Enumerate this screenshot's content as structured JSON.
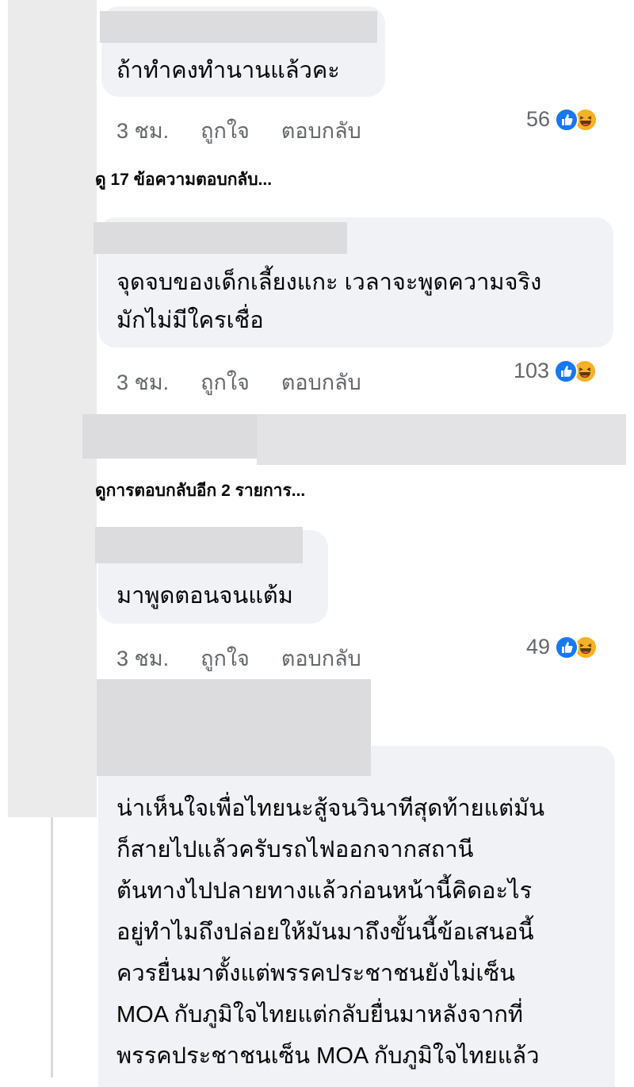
{
  "comments": [
    {
      "text_lines": [
        "ถ้าทำคงทำนานแล้วคะ"
      ],
      "time": "3 ชม.",
      "like_label": "ถูกใจ",
      "reply_label": "ตอบกลับ",
      "reaction_count": "56",
      "reactions": [
        "like-icon",
        "haha-icon"
      ]
    },
    {
      "text_lines": [
        "จุดจบของเด็กเลี้ยงแกะ เวลาจะพูดความจริง",
        "มักไม่มีใครเชื่อ"
      ],
      "time": "3 ชม.",
      "like_label": "ถูกใจ",
      "reply_label": "ตอบกลับ",
      "reaction_count": "103",
      "reactions": [
        "like-icon",
        "haha-icon"
      ]
    },
    {
      "text_lines": [
        "มาพูดตอนจนแต้ม"
      ],
      "time": "3 ชม.",
      "like_label": "ถูกใจ",
      "reply_label": "ตอบกลับ",
      "reaction_count": "49",
      "reactions": [
        "like-icon",
        "haha-icon"
      ]
    },
    {
      "text_lines": [
        "น่าเห็นใจเพื่อไทยนะสู้จนวินาทีสุดท้ายแต่มัน",
        "ก็สายไปแล้วครับรถไฟออกจากสถานี",
        "ต้นทางไปปลายทางแล้วก่อนหน้านี้คิดอะไร",
        "อยู่ทำไมถึงปล่อยให้มันมาถึงขั้นนี้ข้อเสนอนี้",
        "ควรยื่นมาตั้งแต่พรรคประชาชนยังไม่เซ็น",
        "MOA กับภูมิใจไทยแต่กลับยื่นมาหลังจากที่",
        "พรรคประชาชนเซ็น MOA กับภูมิใจไทยแล้ว"
      ]
    }
  ],
  "view_replies": [
    "ดู 17 ข้อความตอบกลับ...",
    "ดูการตอบกลับอีก 2 รายการ..."
  ],
  "colors": {
    "bubble": "#f0f2f5",
    "meta_text": "#65676b",
    "like_blue": "#1877f2",
    "haha_yellow": "#f7b125"
  }
}
